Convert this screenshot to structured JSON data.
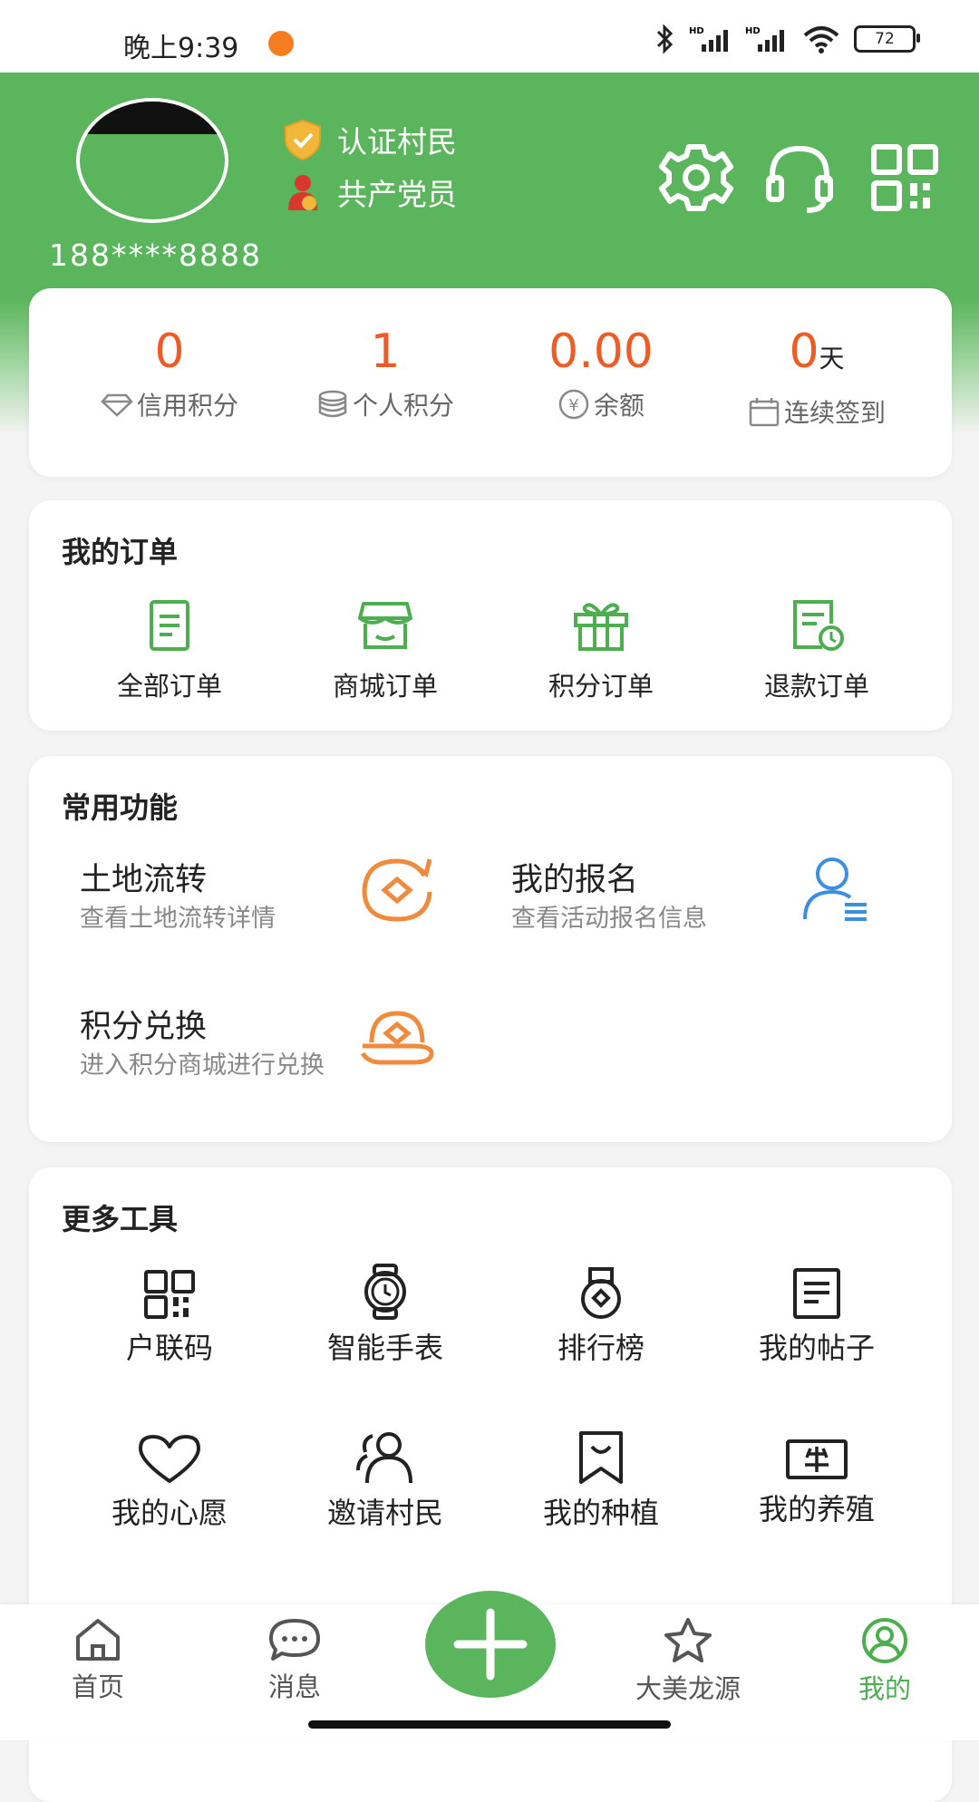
{
  "status_bar": {
    "time": "晚上9:39",
    "battery": "72"
  },
  "profile": {
    "phone": "188****8888",
    "badges": [
      {
        "label": "认证村民",
        "icon": "shield-check-icon"
      },
      {
        "label": "共产党员",
        "icon": "party-member-icon"
      }
    ],
    "actions": [
      "settings-icon",
      "headset-icon",
      "qrcode-icon"
    ]
  },
  "stats": [
    {
      "value": "0",
      "unit": "",
      "label": "信用积分",
      "icon": "diamond-icon"
    },
    {
      "value": "1",
      "unit": "",
      "label": "个人积分",
      "icon": "coins-icon"
    },
    {
      "value": "0.00",
      "unit": "",
      "label": "余额",
      "icon": "yuan-icon"
    },
    {
      "value": "0",
      "unit": "天",
      "label": "连续签到",
      "icon": "calendar-icon"
    }
  ],
  "orders": {
    "title": "我的订单",
    "items": [
      {
        "label": "全部订单",
        "icon": "document-icon"
      },
      {
        "label": "商城订单",
        "icon": "store-icon"
      },
      {
        "label": "积分订单",
        "icon": "gift-icon"
      },
      {
        "label": "退款订单",
        "icon": "refund-icon"
      }
    ]
  },
  "functions": {
    "title": "常用功能",
    "items": [
      {
        "title": "土地流转",
        "subtitle": "查看土地流转详情",
        "icon": "land-transfer-icon"
      },
      {
        "title": "我的报名",
        "subtitle": "查看活动报名信息",
        "icon": "user-list-icon"
      },
      {
        "title": "积分兑换",
        "subtitle": "进入积分商城进行兑换",
        "icon": "exchange-hand-icon"
      }
    ]
  },
  "tools": {
    "title": "更多工具",
    "items": [
      {
        "label": "户联码",
        "icon": "qrcode-icon"
      },
      {
        "label": "智能手表",
        "icon": "watch-icon"
      },
      {
        "label": "排行榜",
        "icon": "medal-icon"
      },
      {
        "label": "我的帖子",
        "icon": "post-icon"
      },
      {
        "label": "我的心愿",
        "icon": "heart-icon"
      },
      {
        "label": "邀请村民",
        "icon": "invite-users-icon"
      },
      {
        "label": "我的种植",
        "icon": "bookmark-icon"
      },
      {
        "label": "我的养殖",
        "icon": "livestock-icon"
      }
    ]
  },
  "nav": {
    "items": [
      {
        "label": "首页",
        "icon": "home-icon"
      },
      {
        "label": "消息",
        "icon": "message-icon"
      },
      {
        "label": "大美龙源",
        "icon": "star-icon"
      },
      {
        "label": "我的",
        "icon": "profile-icon"
      }
    ],
    "fab_icon": "plus-icon",
    "active": "我的"
  },
  "colors": {
    "primary": "#5bb55c",
    "accent": "#f05a24",
    "orange_icon": "#f08a3c",
    "blue_icon": "#3c8fe0"
  }
}
